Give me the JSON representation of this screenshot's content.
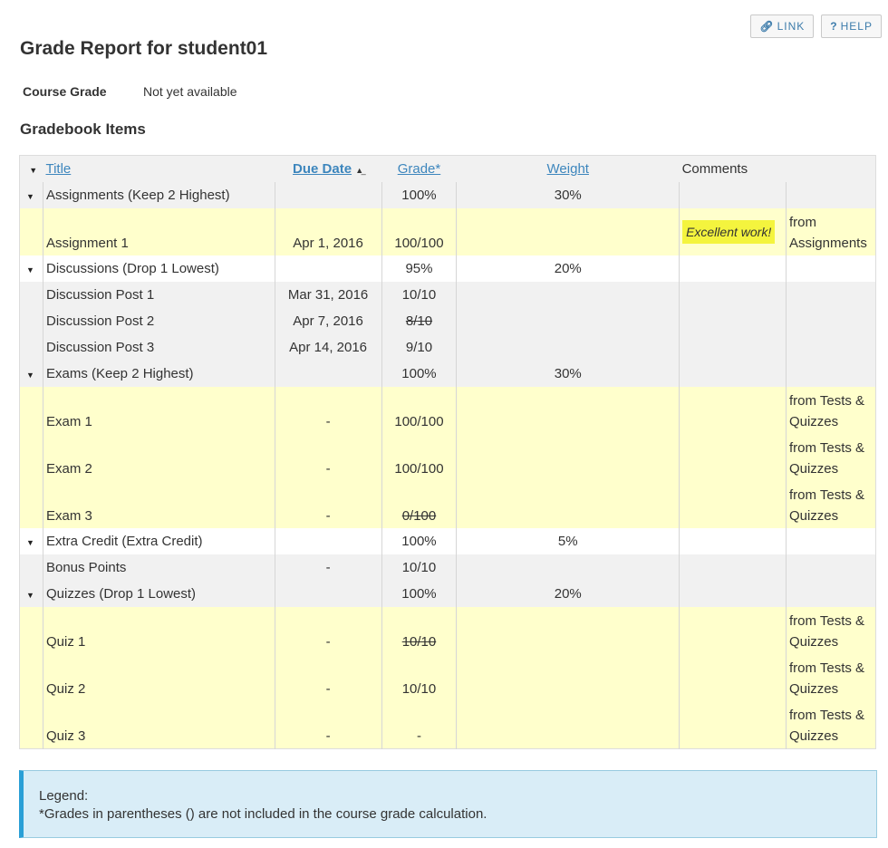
{
  "top_buttons": {
    "link": "LINK",
    "help": "HELP"
  },
  "page_title": "Grade Report for student01",
  "course_grade": {
    "label": "Course Grade",
    "value": "Not yet available"
  },
  "section_title": "Gradebook Items",
  "table_headers": {
    "title": "Title",
    "due_date": "Due Date",
    "grade": "Grade*",
    "weight": "Weight",
    "comments": "Comments"
  },
  "rows": [
    {
      "kind": "cat",
      "bg": "gray",
      "title": "Assignments (Keep 2 Highest)",
      "due": "",
      "grade": "100%",
      "weight": "30%",
      "comment": "",
      "source": ""
    },
    {
      "kind": "item2",
      "bg": "yellow",
      "title": "Assignment 1",
      "due": "Apr 1, 2016",
      "grade": "100/100",
      "weight": "",
      "comment": "Excellent work!",
      "source": "from Assignments"
    },
    {
      "kind": "cat",
      "bg": "white",
      "title": "Discussions (Drop 1 Lowest)",
      "due": "",
      "grade": "95%",
      "weight": "20%",
      "comment": "",
      "source": ""
    },
    {
      "kind": "item1",
      "bg": "gray",
      "title": "Discussion Post 1",
      "due": "Mar 31, 2016",
      "grade": "10/10",
      "weight": "",
      "comment": "",
      "source": ""
    },
    {
      "kind": "item1",
      "bg": "gray",
      "title": "Discussion Post 2",
      "due": "Apr 7, 2016",
      "grade": "8/10",
      "strike": true,
      "weight": "",
      "comment": "",
      "source": ""
    },
    {
      "kind": "item1",
      "bg": "gray",
      "title": "Discussion Post 3",
      "due": "Apr 14, 2016",
      "grade": "9/10",
      "weight": "",
      "comment": "",
      "source": ""
    },
    {
      "kind": "cat",
      "bg": "gray",
      "title": "Exams (Keep 2 Highest)",
      "due": "",
      "grade": "100%",
      "weight": "30%",
      "comment": "",
      "source": ""
    },
    {
      "kind": "item2",
      "bg": "yellow",
      "title": "Exam 1",
      "due": "-",
      "grade": "100/100",
      "weight": "",
      "comment": "",
      "source": "from Tests & Quizzes"
    },
    {
      "kind": "item2",
      "bg": "yellow",
      "title": "Exam 2",
      "due": "-",
      "grade": "100/100",
      "weight": "",
      "comment": "",
      "source": "from Tests & Quizzes"
    },
    {
      "kind": "item2",
      "bg": "yellow",
      "title": "Exam 3",
      "due": "-",
      "grade": "0/100",
      "strike": true,
      "weight": "",
      "comment": "",
      "source": "from Tests & Quizzes"
    },
    {
      "kind": "cat",
      "bg": "white",
      "title": "Extra Credit (Extra Credit)",
      "due": "",
      "grade": "100%",
      "weight": "5%",
      "comment": "",
      "source": ""
    },
    {
      "kind": "item1",
      "bg": "gray",
      "title": "Bonus Points",
      "due": "-",
      "grade": "10/10",
      "weight": "",
      "comment": "",
      "source": ""
    },
    {
      "kind": "cat",
      "bg": "gray",
      "title": "Quizzes (Drop 1 Lowest)",
      "due": "",
      "grade": "100%",
      "weight": "20%",
      "comment": "",
      "source": ""
    },
    {
      "kind": "item2",
      "bg": "yellow",
      "title": "Quiz 1",
      "due": "-",
      "grade": "10/10",
      "strike": true,
      "weight": "",
      "comment": "",
      "source": "from Tests & Quizzes"
    },
    {
      "kind": "item2",
      "bg": "yellow",
      "title": "Quiz 2",
      "due": "-",
      "grade": "10/10",
      "weight": "",
      "comment": "",
      "source": "from Tests & Quizzes"
    },
    {
      "kind": "item2",
      "bg": "yellow",
      "title": "Quiz 3",
      "due": "-",
      "grade": "-",
      "weight": "",
      "comment": "",
      "source": "from Tests & Quizzes"
    }
  ],
  "legend": {
    "title": "Legend:",
    "text": "*Grades in parentheses () are not included in the course grade calculation."
  },
  "colors": {
    "link": "#3d86bd",
    "row_gray": "#f1f1f1",
    "row_yellow": "#ffffcc",
    "comment_badge": "#f4f43e",
    "legend_bg": "#d9edf7",
    "legend_border": "#2a9fd6"
  },
  "icons": {
    "link": "link-icon",
    "help": "question-icon",
    "expand": "caret-down-icon",
    "sort": "sort-ascending-icon"
  }
}
